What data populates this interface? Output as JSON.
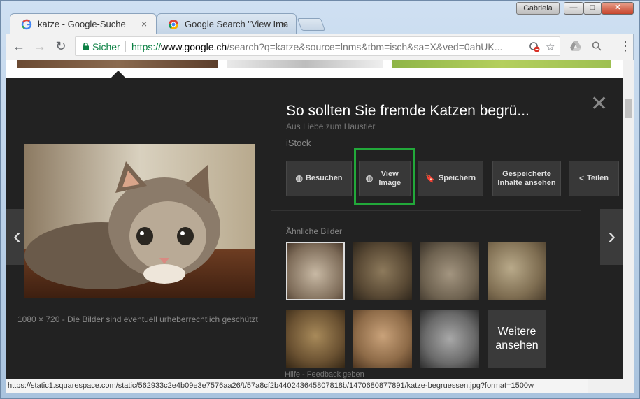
{
  "window": {
    "user": "Gabriela",
    "min": "—",
    "max": "□",
    "close": "✕"
  },
  "tabs": [
    {
      "title": "katze - Google-Suche",
      "close": "×"
    },
    {
      "title": "Google Search \"View Ima",
      "close": "×"
    }
  ],
  "toolbar": {
    "back": "←",
    "forward": "→",
    "reload": "↻",
    "secure_label": "Sicher",
    "url_scheme": "https://",
    "url_host": "www.google.ch",
    "url_rest": "/search?q=katze&source=lnms&tbm=isch&sa=X&ved=0ahUK...",
    "star": "☆",
    "search": "⚲",
    "menu": "⋮"
  },
  "viewer": {
    "title": "So sollten Sie fremde Katzen begrü...",
    "subtitle": "Aus Liebe zum Haustier",
    "source": "iStock",
    "close": "✕",
    "prev": "‹",
    "next": "›",
    "image_meta": "1080 × 720  -  Die Bilder sind eventuell urheberrechtlich geschützt",
    "buttons": {
      "visit": "Besuchen",
      "view_image": "View Image",
      "save": "Speichern",
      "saved": "Gespeicherte Inhalte ansehen",
      "share": "Teilen"
    },
    "similar_label": "Ähnliche Bilder",
    "more_label": "Weitere ansehen",
    "footer": "Hilfe  -  Feedback geben"
  },
  "status_url": "https://static1.squarespace.com/static/562933c2e4b09e3e7576aa26/t/57a8cf2b440243645807818b/1470680877891/katze-begruessen.jpg?format=1500w",
  "colors": {
    "highlight": "#22a93a",
    "secure": "#0b8043",
    "panel": "#222222"
  }
}
